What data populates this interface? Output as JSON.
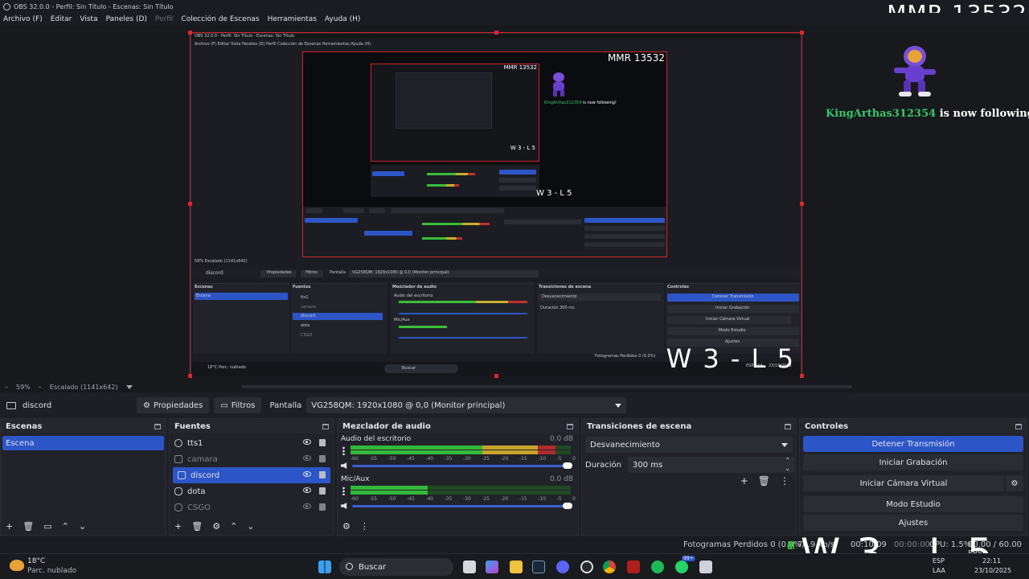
{
  "window": {
    "title": "OBS 32.0.0 - Perfil: Sin Título - Escenas: Sin Título"
  },
  "menu": [
    "Archivo (F)",
    "Editar",
    "Vista",
    "Paneles (D)",
    "Perfil",
    "Colección de Escenas",
    "Herramientas",
    "Ayuda (H)"
  ],
  "overlay": {
    "mmr": "MMR 13532",
    "follower_name": "KingArthas312354",
    "follower_text": " is now following!",
    "record": "W 3 - L 5"
  },
  "preview_status": {
    "zoom": "59%",
    "scaling": "Escalado (1141x642)"
  },
  "source_toolbar": {
    "source_name": "discord",
    "properties_label": "Propiedades",
    "filters_label": "Filtros",
    "display_label": "Pantalla",
    "display_value": "VG258QM: 1920x1080 @ 0,0 (Monitor principal)"
  },
  "scenes": {
    "title": "Escenas",
    "items": [
      "Escena"
    ]
  },
  "sources": {
    "title": "Fuentes",
    "items": [
      {
        "name": "tts1",
        "visible": true,
        "state": "normal"
      },
      {
        "name": "camara",
        "visible": false,
        "state": "dim"
      },
      {
        "name": "discord",
        "visible": true,
        "state": "selected"
      },
      {
        "name": "dota",
        "visible": true,
        "state": "normal"
      },
      {
        "name": "CSGO",
        "visible": false,
        "state": "dim"
      }
    ]
  },
  "mixer": {
    "title": "Mezclador de audio",
    "channels": [
      {
        "name": "Audio del escritorio",
        "db": "0.0 dB",
        "level": 0.93
      },
      {
        "name": "Mic/Aux",
        "db": "0.0 dB",
        "level": 0.35
      }
    ],
    "scale": [
      "-60",
      "-55",
      "-50",
      "-45",
      "-40",
      "-35",
      "-30",
      "-25",
      "-20",
      "-15",
      "-10",
      "-5",
      "0"
    ]
  },
  "transitions": {
    "title": "Transiciones de escena",
    "type": "Desvanecimiento",
    "duration_label": "Duración",
    "duration_value": "300 ms"
  },
  "controls": {
    "title": "Controles",
    "buttons": [
      "Detener Transmisión",
      "Iniciar Grabación",
      "Iniciar Cámara Virtual",
      "Modo Estudio",
      "Ajustes"
    ]
  },
  "status_bar": {
    "dropped": "Fotogramas Perdidos 0 (0.0%)",
    "kbps": "74.9 kb/s",
    "stream_time": "00:10:09",
    "rec_time": "00:00:00",
    "cpu": "CPU: 1.5%",
    "fps": "60.00 / 60.00 FPS"
  },
  "taskbar": {
    "weather_temp": "18°C",
    "weather_desc": "Parc. nublado",
    "search": "Buscar",
    "lang": "ESP",
    "lang2": "LAA",
    "time": "22:11",
    "date": "23/10/2025",
    "notif_badge": "99+"
  },
  "colors": {
    "accent": "#2c55c7",
    "selection_border": "#d1242a",
    "follower": "#36c76a"
  }
}
